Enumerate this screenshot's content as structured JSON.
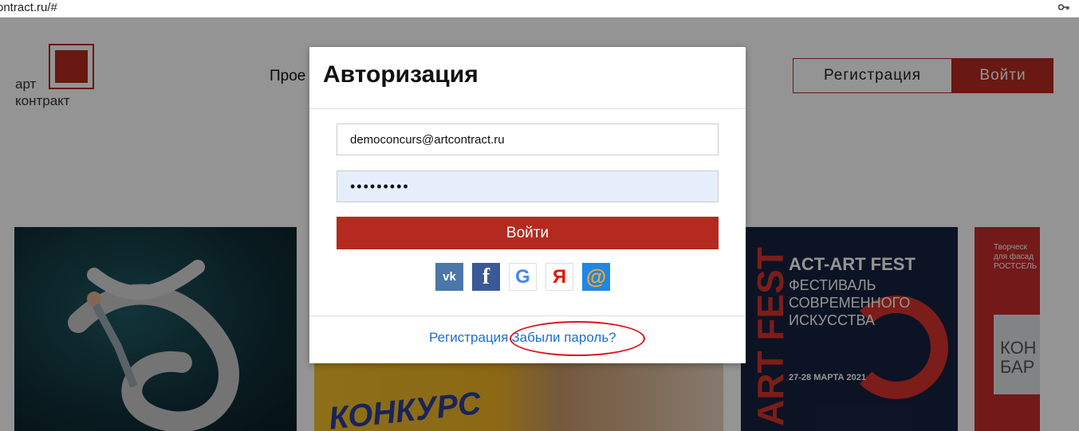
{
  "browser": {
    "url": "ontract.ru/#",
    "key_icon": "key-icon"
  },
  "header": {
    "logo_line1": "арт",
    "logo_line2": "контракт",
    "nav_text": "Прое",
    "register_label": "Регистрация",
    "login_label": "Войти"
  },
  "cards": {
    "card2_text": "КОНКУРС",
    "card3_title": "ACT-ART FEST",
    "card3_subtitle": "ФЕСТИВАЛЬ СОВРЕМЕННОГО ИСКУССТВА",
    "card3_date": "27-28 МАРТА 2021",
    "card3_vertical": "ART FEST",
    "card4_text": "Творческ для фасад РОСТСЕЛЬ",
    "card4_block": "КОН БАР"
  },
  "modal": {
    "title": "Авторизация",
    "email_value": "democoncurs@artcontract.ru",
    "password_value": "•••••••••",
    "submit_label": "Войти",
    "socials": [
      {
        "name": "vk",
        "glyph": "vk"
      },
      {
        "name": "facebook",
        "glyph": "f"
      },
      {
        "name": "google",
        "glyph": "G"
      },
      {
        "name": "yandex",
        "glyph": "Я"
      },
      {
        "name": "mail",
        "glyph": "@"
      }
    ],
    "register_link": "Регистрация",
    "forgot_link": "Забыли пароль?"
  },
  "colors": {
    "accent": "#b52a1f",
    "link": "#1a6ed6",
    "highlight": "#e0121b"
  }
}
